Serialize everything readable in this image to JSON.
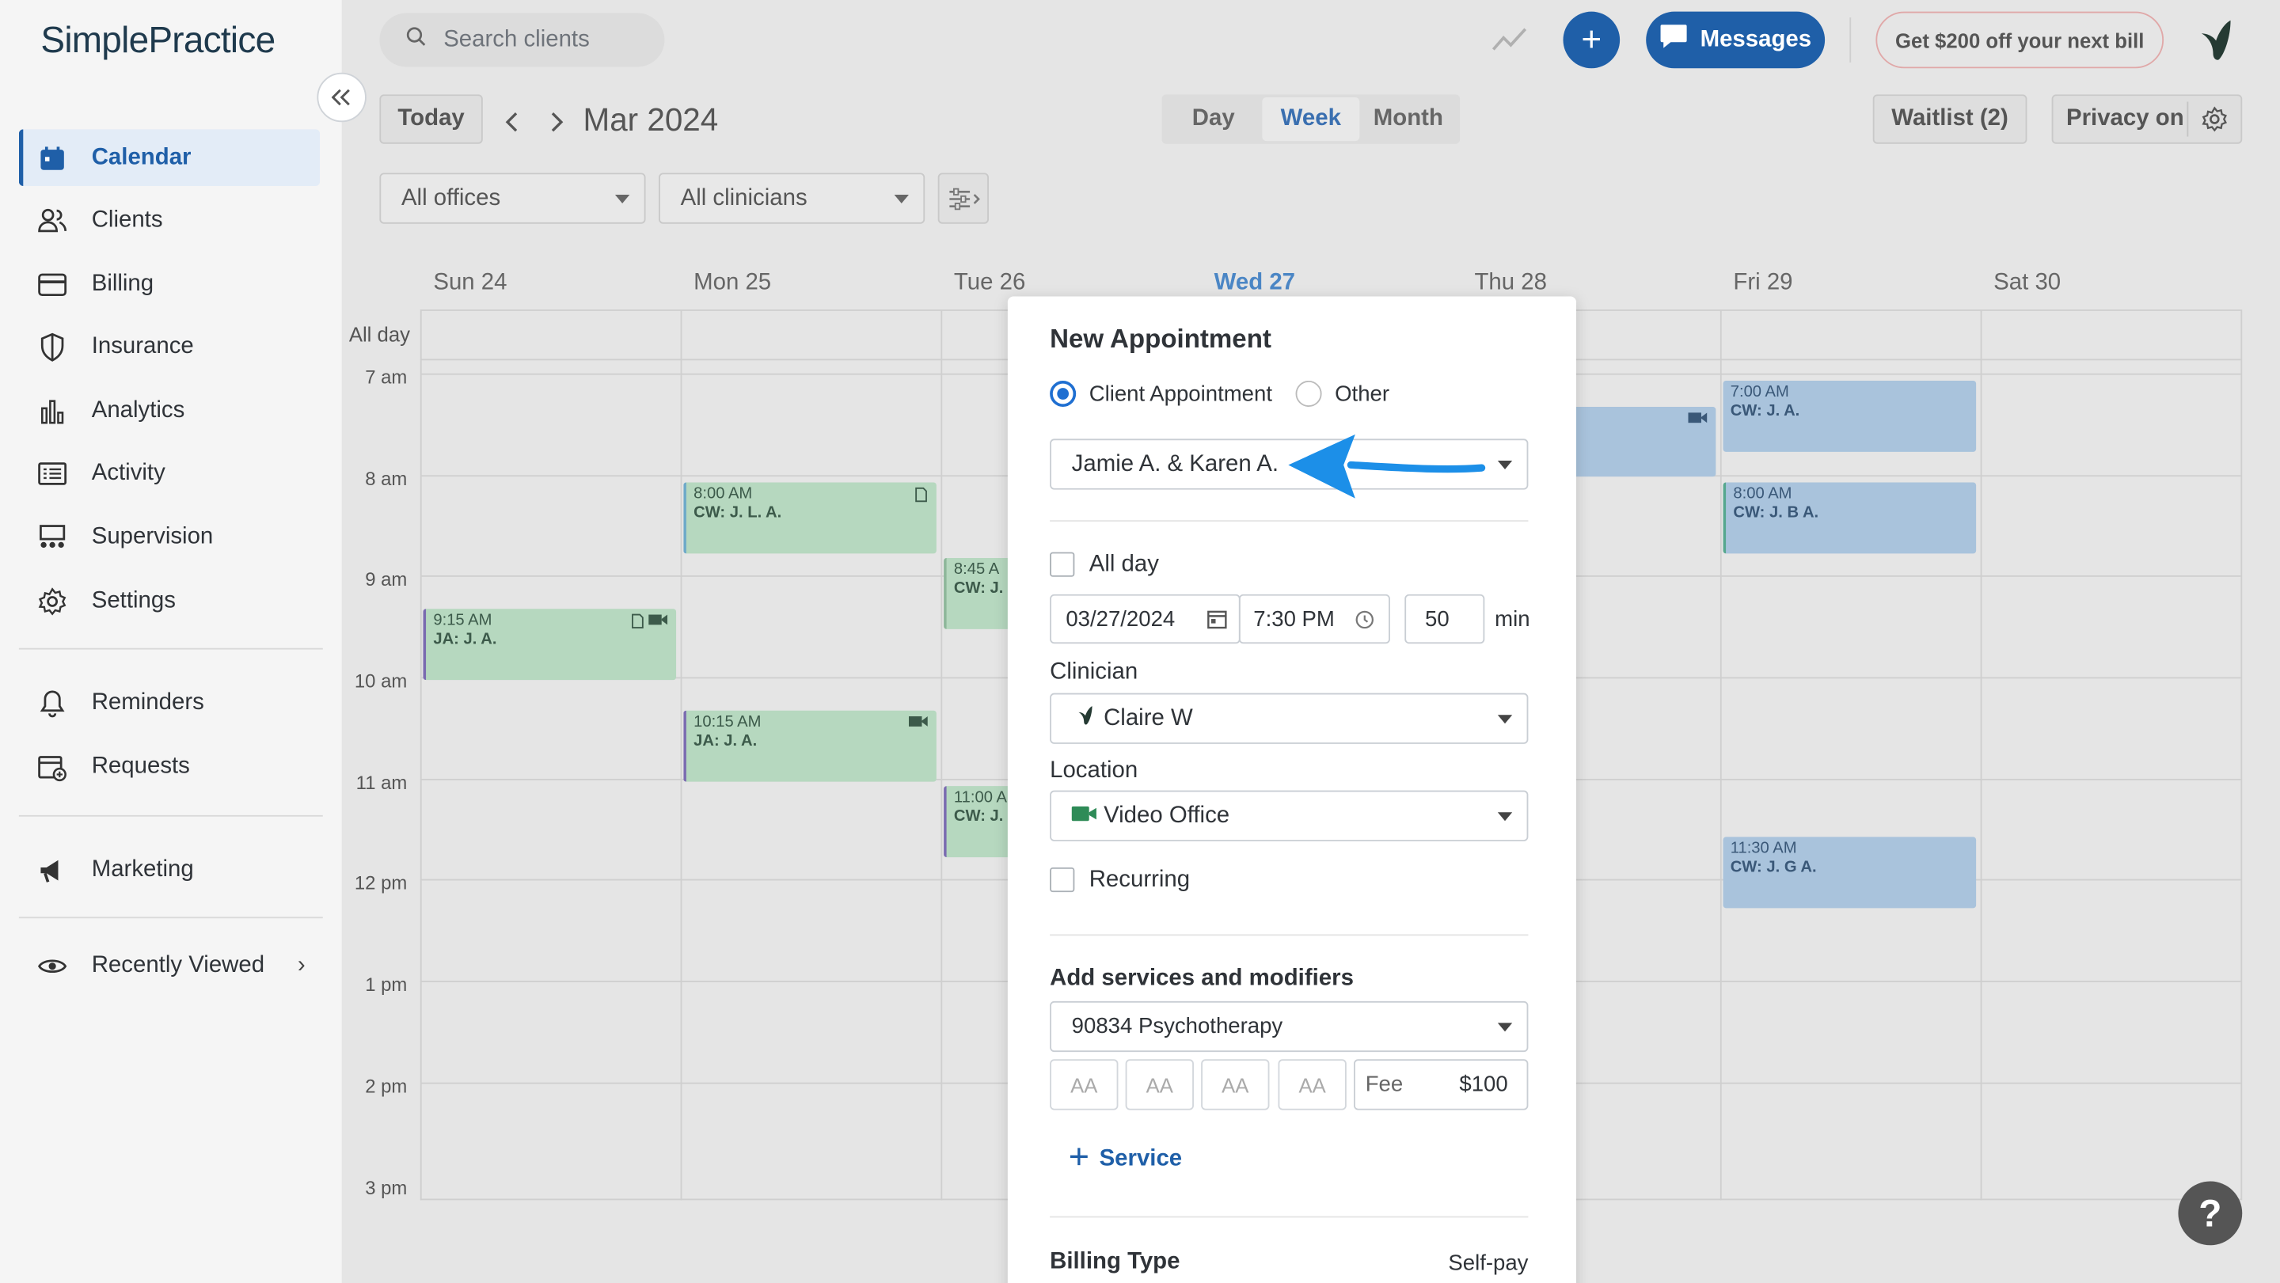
{
  "app": {
    "logo": "SimplePractice"
  },
  "sidebar": {
    "items": [
      {
        "label": "Calendar",
        "icon": "calendar-icon",
        "active": true
      },
      {
        "label": "Clients",
        "icon": "users-icon"
      },
      {
        "label": "Billing",
        "icon": "credit-card-icon"
      },
      {
        "label": "Insurance",
        "icon": "shield-icon"
      },
      {
        "label": "Analytics",
        "icon": "bar-chart-icon"
      },
      {
        "label": "Activity",
        "icon": "list-icon"
      },
      {
        "label": "Supervision",
        "icon": "supervision-icon"
      },
      {
        "label": "Settings",
        "icon": "gear-icon"
      },
      {
        "label": "Reminders",
        "icon": "bell-icon"
      },
      {
        "label": "Requests",
        "icon": "calendar-plus-icon"
      },
      {
        "label": "Marketing",
        "icon": "megaphone-icon"
      },
      {
        "label": "Recently Viewed",
        "icon": "eye-icon"
      }
    ]
  },
  "topbar": {
    "search_placeholder": "Search clients",
    "plus_label": "+",
    "messages_label": "Messages",
    "promo_label": "Get $200 off your next bill"
  },
  "toolbar": {
    "today_label": "Today",
    "month_title": "Mar 2024",
    "views": [
      "Day",
      "Week",
      "Month"
    ],
    "selected_view": "Week",
    "waitlist_label": "Waitlist (2)",
    "privacy_label": "Privacy on",
    "offices_select": "All offices",
    "clinicians_select": "All clinicians"
  },
  "calendar": {
    "days": [
      "Sun 24",
      "Mon 25",
      "Tue 26",
      "Wed 27",
      "Thu 28",
      "Fri 29",
      "Sat 30"
    ],
    "today": "Wed 27",
    "allday_label": "All day",
    "hours": [
      "7 am",
      "8 am",
      "9 am",
      "10 am",
      "11 am",
      "12 pm",
      "1 pm",
      "2 pm",
      "3 pm"
    ],
    "events": [
      {
        "time": "9:15 AM",
        "who": "JA: J. A."
      },
      {
        "time": "8:00 AM",
        "who": "CW: J. L. A."
      },
      {
        "time": "10:15 AM",
        "who": "JA: J. A."
      },
      {
        "time": "8:45 A",
        "who": "CW: J."
      },
      {
        "time": "11:00 A",
        "who": "CW: J."
      },
      {
        "time": "7:00 AM",
        "who": "CW: J. A."
      },
      {
        "time": "8:00 AM",
        "who": "CW: J. B A."
      },
      {
        "time": "11:30 AM",
        "who": "CW: J. G A."
      }
    ]
  },
  "modal": {
    "title": "New Appointment",
    "type_client": "Client Appointment",
    "type_other": "Other",
    "client_value": "Jamie A. & Karen A.",
    "allday_label": "All day",
    "date_value": "03/27/2024",
    "time_value": "7:30 PM",
    "duration_value": "50",
    "duration_unit": "min",
    "clinician_label": "Clinician",
    "clinician_value": "Claire W",
    "location_label": "Location",
    "location_value": "Video Office",
    "recurring_label": "Recurring",
    "services_header": "Add services and modifiers",
    "service_value": "90834 Psychotherapy",
    "modifiers": [
      "AA",
      "AA",
      "AA",
      "AA"
    ],
    "fee_label": "Fee",
    "fee_value": "$100",
    "add_service_label": "Service",
    "billing_type_label": "Billing Type",
    "billing_type_value": "Self-pay"
  },
  "help_label": "?",
  "colors": {
    "brand_blue": "#1f5fa8",
    "event_green": "#b6d8bf",
    "event_blue": "#a9c3dc",
    "arrow_blue": "#1c8fe8"
  }
}
